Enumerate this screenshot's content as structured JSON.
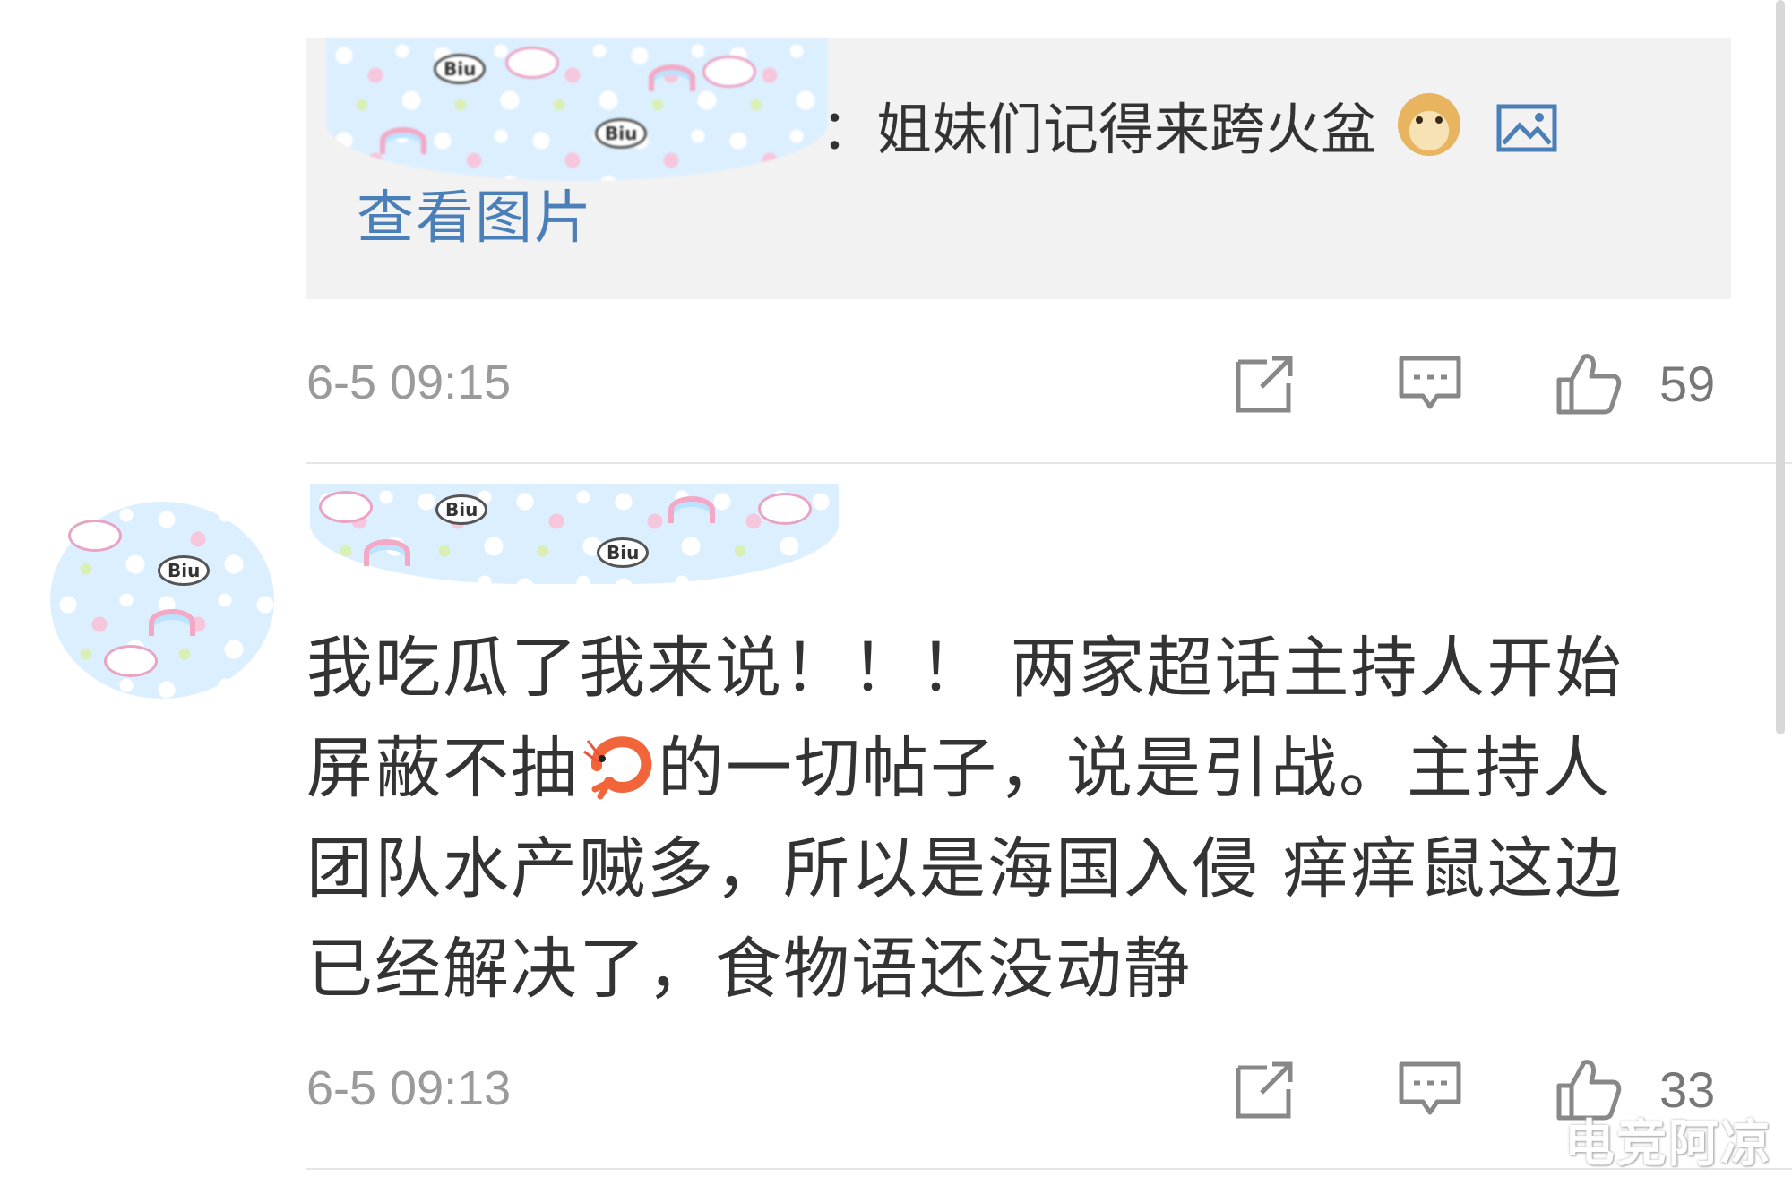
{
  "reply": {
    "text": "：姐妹们记得来跨火盆",
    "emoji_icon": "doge-emoji",
    "view_image_label": "查看图片"
  },
  "comment_1": {
    "time": "6-5 09:15",
    "like_count": "59"
  },
  "comment_2": {
    "lines": [
      "我吃瓜了我来说！！！ 两家超话主持人开始",
      [
        "屏蔽不抽",
        "的一切帖子，说是引战。主持人"
      ],
      "团队水产贼多，所以是海国入侵 痒痒鼠这边",
      "已经解决了，食物语还没动静"
    ],
    "inline_emoji": "shrimp-emoji",
    "time": "6-5 09:13",
    "like_count": "33"
  },
  "watermark": "电竞阿凉",
  "colors": {
    "link": "#4a7fb8",
    "meta": "#9a9a9a",
    "reply_bg": "#f2f2f2"
  }
}
